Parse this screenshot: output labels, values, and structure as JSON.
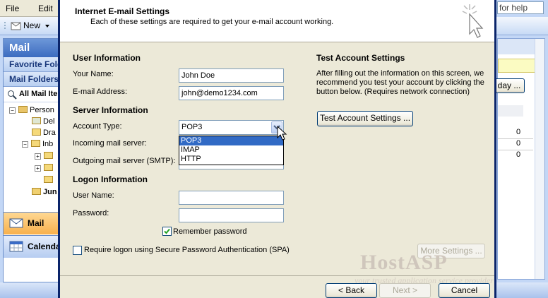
{
  "background": {
    "menu": {
      "file": "File",
      "edit": "Edit"
    },
    "toolbar": {
      "new_label": "New"
    },
    "nav": {
      "title": "Mail",
      "favorite_folders": "Favorite Fold",
      "mail_folders": "Mail Folders",
      "all_mail_items": "All Mail Ite",
      "tree": [
        "Person",
        "Del",
        "Dra",
        "Inb",
        "",
        "",
        "",
        "Jun"
      ],
      "mail_button": "Mail",
      "calendar_button": "Calenda"
    },
    "right": {
      "help_text": "for help",
      "today_button": "day ...",
      "counts": [
        "0",
        "0",
        "0"
      ]
    }
  },
  "dialog": {
    "title": "Internet E-mail Settings",
    "subtitle": "Each of these settings are required to get your e-mail account working.",
    "user_info": {
      "heading": "User Information",
      "name_label": "Your Name:",
      "name_value": "John Doe",
      "email_label": "E-mail Address:",
      "email_value": "john@demo1234.com"
    },
    "server_info": {
      "heading": "Server Information",
      "account_type_label": "Account Type:",
      "account_type_value": "POP3",
      "account_type_options": [
        "POP3",
        "IMAP",
        "HTTP"
      ],
      "incoming_label": "Incoming mail server:",
      "outgoing_label": "Outgoing mail server (SMTP):"
    },
    "logon_info": {
      "heading": "Logon Information",
      "username_label": "User Name:",
      "username_value": "",
      "password_label": "Password:",
      "password_value": "",
      "remember_label": "Remember password",
      "remember_checked": true,
      "spa_label": "Require logon using Secure Password Authentication (SPA)",
      "spa_checked": false
    },
    "test": {
      "heading": "Test Account Settings",
      "description": "After filling out the information on this screen, we recommend you test your account by clicking the button below. (Requires network connection)",
      "button": "Test Account Settings ..."
    },
    "more_settings": "More Settings ...",
    "buttons": {
      "back": "< Back",
      "next": "Next >",
      "cancel": "Cancel"
    },
    "watermark": {
      "brand": "HostASP",
      "tagline": "your trusted application service provider"
    }
  }
}
